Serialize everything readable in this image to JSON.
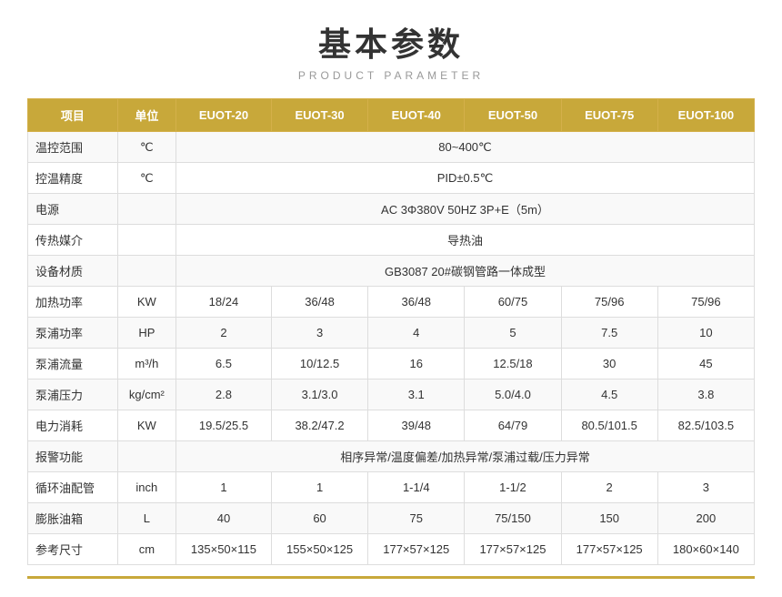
{
  "header": {
    "title": "基本参数",
    "subtitle": "PRODUCT PARAMETER"
  },
  "table": {
    "columns": [
      {
        "key": "item",
        "label": "项目"
      },
      {
        "key": "unit",
        "label": "单位"
      },
      {
        "key": "euot20",
        "label": "EUOT-20"
      },
      {
        "key": "euot30",
        "label": "EUOT-30"
      },
      {
        "key": "euot40",
        "label": "EUOT-40"
      },
      {
        "key": "euot50",
        "label": "EUOT-50"
      },
      {
        "key": "euot75",
        "label": "EUOT-75"
      },
      {
        "key": "euot100",
        "label": "EUOT-100"
      }
    ],
    "rows": [
      {
        "item": "温控范围",
        "unit": "℃",
        "span": true,
        "spanValue": "80~400℃"
      },
      {
        "item": "控温精度",
        "unit": "℃",
        "span": true,
        "spanValue": "PID±0.5℃"
      },
      {
        "item": "电源",
        "unit": "",
        "span": true,
        "spanValue": "AC 3Φ380V 50HZ  3P+E（5m）"
      },
      {
        "item": "传热媒介",
        "unit": "",
        "span": true,
        "spanValue": "导热油"
      },
      {
        "item": "设备材质",
        "unit": "",
        "span": true,
        "spanValue": "GB3087   20#碳钢管路一体成型"
      },
      {
        "item": "加热功率",
        "unit": "KW",
        "span": false,
        "values": [
          "18/24",
          "36/48",
          "36/48",
          "60/75",
          "75/96",
          "75/96"
        ]
      },
      {
        "item": "泵浦功率",
        "unit": "HP",
        "span": false,
        "values": [
          "2",
          "3",
          "4",
          "5",
          "7.5",
          "10"
        ]
      },
      {
        "item": "泵浦流量",
        "unit": "m³/h",
        "span": false,
        "values": [
          "6.5",
          "10/12.5",
          "16",
          "12.5/18",
          "30",
          "45"
        ]
      },
      {
        "item": "泵浦压力",
        "unit": "kg/cm²",
        "span": false,
        "values": [
          "2.8",
          "3.1/3.0",
          "3.1",
          "5.0/4.0",
          "4.5",
          "3.8"
        ]
      },
      {
        "item": "电力消耗",
        "unit": "KW",
        "span": false,
        "values": [
          "19.5/25.5",
          "38.2/47.2",
          "39/48",
          "64/79",
          "80.5/101.5",
          "82.5/103.5"
        ]
      },
      {
        "item": "报警功能",
        "unit": "",
        "span": true,
        "spanValue": "相序异常/温度偏差/加热异常/泵浦过载/压力异常"
      },
      {
        "item": "循环油配管",
        "unit": "inch",
        "span": false,
        "values": [
          "1",
          "1",
          "1-1/4",
          "1-1/2",
          "2",
          "3"
        ]
      },
      {
        "item": "膨胀油箱",
        "unit": "L",
        "span": false,
        "values": [
          "40",
          "60",
          "75",
          "75/150",
          "150",
          "200"
        ]
      },
      {
        "item": "参考尺寸",
        "unit": "cm",
        "span": false,
        "values": [
          "135×50×115",
          "155×50×125",
          "177×57×125",
          "177×57×125",
          "177×57×125",
          "180×60×140"
        ]
      }
    ]
  }
}
